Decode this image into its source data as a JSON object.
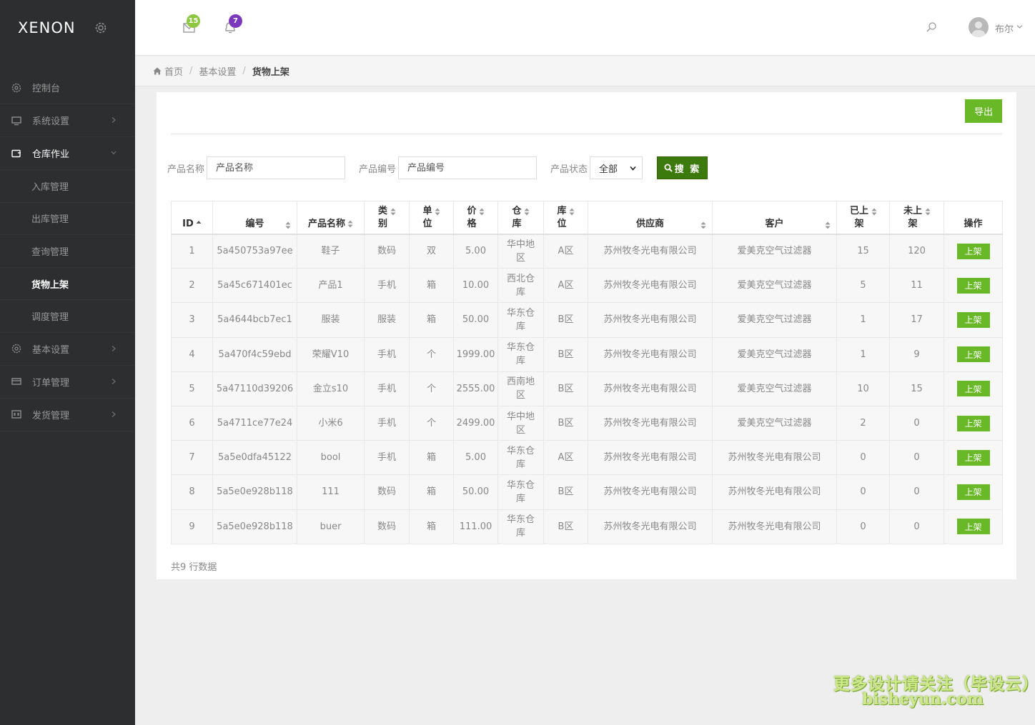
{
  "app": {
    "logo": "XENON"
  },
  "sidebar": {
    "items": [
      {
        "label": "控制台",
        "icon": "dashboard-icon"
      },
      {
        "label": "系统设置",
        "icon": "monitor-icon"
      },
      {
        "label": "仓库作业",
        "icon": "warehouse-icon",
        "open": true,
        "children": [
          {
            "label": "入库管理"
          },
          {
            "label": "出库管理"
          },
          {
            "label": "查询管理"
          },
          {
            "label": "货物上架",
            "active": true
          },
          {
            "label": "调度管理"
          }
        ]
      },
      {
        "label": "基本设置",
        "icon": "settings-icon"
      },
      {
        "label": "订单管理",
        "icon": "order-icon"
      },
      {
        "label": "发货管理",
        "icon": "shipping-icon"
      }
    ]
  },
  "header": {
    "mail_count": "15",
    "notify_count": "7",
    "username": "布尔"
  },
  "breadcrumb": {
    "home": "首页",
    "level1": "基本设置",
    "current": "货物上架"
  },
  "toolbar": {
    "export_label": "导出",
    "search_label": "搜 索"
  },
  "filters": {
    "name_label": "产品名称",
    "name_placeholder": "产品名称",
    "code_label": "产品编号",
    "code_placeholder": "产品编号",
    "status_label": "产品状态",
    "status_value": "全部"
  },
  "table": {
    "headers": {
      "id": "ID",
      "code": "编号",
      "name": "产品名称",
      "category": "类别",
      "unit": "单位",
      "price": "价格",
      "warehouse": "仓库",
      "location": "库位",
      "supplier": "供应商",
      "customer": "客户",
      "shelved": "已上架",
      "unshelved": "未上架",
      "action": "操作"
    },
    "action_label": "上架",
    "rows": [
      {
        "id": "1",
        "code": "5a450753a97ee",
        "name": "鞋子",
        "category": "数码",
        "unit": "双",
        "price": "5.00",
        "warehouse": "华中地区",
        "location": "A区",
        "supplier": "苏州牧冬光电有限公司",
        "customer": "爱美克空气过滤器",
        "shelved": "15",
        "unshelved": "120"
      },
      {
        "id": "2",
        "code": "5a45c671401ec",
        "name": "产品1",
        "category": "手机",
        "unit": "箱",
        "price": "10.00",
        "warehouse": "西北仓库",
        "location": "A区",
        "supplier": "苏州牧冬光电有限公司",
        "customer": "爱美克空气过滤器",
        "shelved": "5",
        "unshelved": "11"
      },
      {
        "id": "3",
        "code": "5a4644bcb7ec1",
        "name": "服装",
        "category": "服装",
        "unit": "箱",
        "price": "50.00",
        "warehouse": "华东仓库",
        "location": "B区",
        "supplier": "苏州牧冬光电有限公司",
        "customer": "爱美克空气过滤器",
        "shelved": "1",
        "unshelved": "17"
      },
      {
        "id": "4",
        "code": "5a470f4c59ebd",
        "name": "荣耀V10",
        "category": "手机",
        "unit": "个",
        "price": "1999.00",
        "warehouse": "华东仓库",
        "location": "B区",
        "supplier": "苏州牧冬光电有限公司",
        "customer": "爱美克空气过滤器",
        "shelved": "1",
        "unshelved": "9"
      },
      {
        "id": "5",
        "code": "5a47110d39206",
        "name": "金立s10",
        "category": "手机",
        "unit": "个",
        "price": "2555.00",
        "warehouse": "西南地区",
        "location": "B区",
        "supplier": "苏州牧冬光电有限公司",
        "customer": "爱美克空气过滤器",
        "shelved": "10",
        "unshelved": "15"
      },
      {
        "id": "6",
        "code": "5a4711ce77e24",
        "name": "小米6",
        "category": "手机",
        "unit": "个",
        "price": "2499.00",
        "warehouse": "华中地区",
        "location": "B区",
        "supplier": "苏州牧冬光电有限公司",
        "customer": "爱美克空气过滤器",
        "shelved": "2",
        "unshelved": "0"
      },
      {
        "id": "7",
        "code": "5a5e0dfa45122",
        "name": "bool",
        "category": "手机",
        "unit": "箱",
        "price": "5.00",
        "warehouse": "华东仓库",
        "location": "A区",
        "supplier": "苏州牧冬光电有限公司",
        "customer": "苏州牧冬光电有限公司",
        "shelved": "0",
        "unshelved": "0"
      },
      {
        "id": "8",
        "code": "5a5e0e928b118",
        "name": "111",
        "category": "数码",
        "unit": "箱",
        "price": "50.00",
        "warehouse": "华东仓库",
        "location": "B区",
        "supplier": "苏州牧冬光电有限公司",
        "customer": "苏州牧冬光电有限公司",
        "shelved": "0",
        "unshelved": "0"
      },
      {
        "id": "9",
        "code": "5a5e0e928b118",
        "name": "buer",
        "category": "数码",
        "unit": "箱",
        "price": "111.00",
        "warehouse": "华东仓库",
        "location": "B区",
        "supplier": "苏州牧冬光电有限公司",
        "customer": "苏州牧冬光电有限公司",
        "shelved": "0",
        "unshelved": "0"
      }
    ]
  },
  "footer": {
    "count_text": "共9 行数据"
  },
  "watermark": {
    "line1": "更多设计请关注（毕设云）",
    "line2": "bisheyun.com"
  },
  "colors": {
    "accent": "#68b828",
    "search_button": "#3c7a0d",
    "sidebar_bg": "#2c2e2f",
    "badge_green": "#8dc63f",
    "badge_purple": "#7c38bc"
  }
}
